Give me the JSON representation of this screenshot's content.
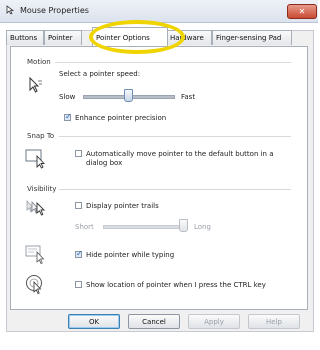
{
  "window": {
    "title": "Mouse Properties",
    "close_label": "✕"
  },
  "tabs": [
    {
      "label": "Buttons"
    },
    {
      "label": "Pointer"
    },
    {
      "label": "Pointer Options",
      "active": true
    },
    {
      "label": "Hardware"
    },
    {
      "label": "Finger-sensing Pad"
    }
  ],
  "motion": {
    "title": "Motion",
    "speed_label": "Select a pointer speed:",
    "slow_label": "Slow",
    "fast_label": "Fast",
    "speed_level": 0.5,
    "enhance_label": "Enhance pointer precision",
    "enhance_checked": true
  },
  "snap_to": {
    "title": "Snap To",
    "auto_label_line1": "Automatically move pointer to the default button in a",
    "auto_label_line2": "dialog box",
    "auto_checked": false
  },
  "visibility": {
    "title": "Visibility",
    "trails_label": "Display pointer trails",
    "trails_checked": false,
    "short_label": "Short",
    "long_label": "Long",
    "trails_level": 1.0,
    "hide_label": "Hide pointer while typing",
    "hide_checked": true,
    "show_location_label": "Show location of pointer when I press the CTRL key",
    "show_location_checked": false
  },
  "buttons": {
    "ok": "OK",
    "cancel": "Cancel",
    "apply": "Apply",
    "help": "Help"
  },
  "colors": {
    "highlight": "#f0d400",
    "accent": "#3c7fb1"
  }
}
